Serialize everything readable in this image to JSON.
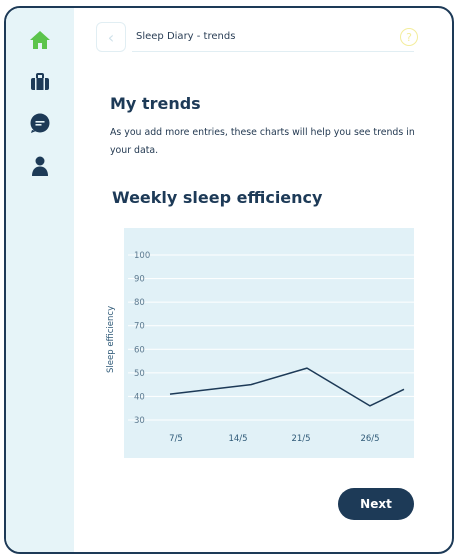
{
  "colors": {
    "brand_dark": "#1d3a57",
    "home_icon": "#5cc44c",
    "sidebar_bg": "#e6f4f8",
    "chart_bg": "#e1f1f7"
  },
  "sidebar": {
    "items": [
      {
        "icon": "home-icon"
      },
      {
        "icon": "briefcase-icon"
      },
      {
        "icon": "chat-icon"
      },
      {
        "icon": "user-icon"
      }
    ]
  },
  "header": {
    "back_icon": "chevron-left-icon",
    "title": "Sleep Diary - trends",
    "help_label": "?"
  },
  "main": {
    "heading": "My trends",
    "description": "As you add more entries, these charts will help you see trends in your data.",
    "chart_title": "Weekly sleep efficiency"
  },
  "chart_data": {
    "type": "line",
    "title": "Weekly sleep efficiency",
    "xlabel": "",
    "ylabel": "Sleep efficiency",
    "ylim": [
      30,
      100
    ],
    "yticks": [
      100,
      90,
      80,
      70,
      60,
      50,
      40,
      30
    ],
    "categories": [
      "7/5",
      "14/5",
      "21/5",
      "26/5"
    ],
    "series": [
      {
        "values": [
          41,
          45,
          52,
          36
        ]
      }
    ],
    "trailing_value": 43,
    "grid": true
  },
  "footer": {
    "next_label": "Next"
  }
}
